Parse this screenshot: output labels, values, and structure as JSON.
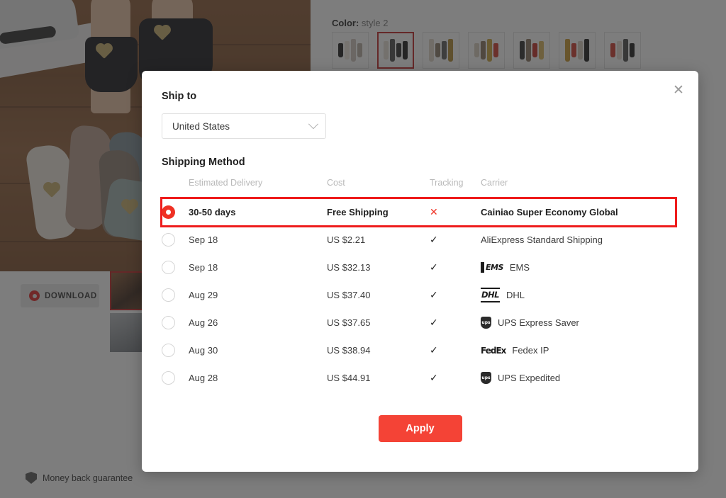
{
  "background": {
    "color_label": "Color:",
    "color_value": "style 2",
    "download_label": "DOWNLOAD",
    "money_back": "Money back guarantee",
    "swatches": [
      {
        "name": "swatch-1",
        "colors": [
          "#1a1a1a",
          "#efe6dd",
          "#cfc6bd",
          "#b9ada2"
        ]
      },
      {
        "name": "swatch-2",
        "colors": [
          "#e8e0d6",
          "#4a4a4a",
          "#2a2a2a",
          "#1a1a1a"
        ]
      },
      {
        "name": "swatch-3",
        "colors": [
          "#e0d6c8",
          "#8a7a66",
          "#5a5a5a",
          "#b08a30"
        ]
      },
      {
        "name": "swatch-4",
        "colors": [
          "#d8cdbd",
          "#8a7560",
          "#caa23a",
          "#d0392b"
        ]
      },
      {
        "name": "swatch-5",
        "colors": [
          "#2a2a2a",
          "#8a7560",
          "#c22a22",
          "#d8b45a"
        ]
      },
      {
        "name": "swatch-6",
        "colors": [
          "#c8962c",
          "#d0392b",
          "#d8cdbd",
          "#1a1a1a"
        ]
      },
      {
        "name": "swatch-7",
        "colors": [
          "#d0392b",
          "#e6ddd2",
          "#4a4a4a",
          "#1a1a1a"
        ]
      }
    ]
  },
  "modal": {
    "close_icon": "close-icon",
    "ship_to_title": "Ship to",
    "country": {
      "value": "United States",
      "chevron_icon": "chevron-down-icon"
    },
    "shipping_method_title": "Shipping Method",
    "columns": [
      "",
      "Estimated Delivery",
      "Cost",
      "Tracking",
      "Carrier"
    ],
    "rows": [
      {
        "selected": true,
        "eta": "30-50 days",
        "cost": "Free Shipping",
        "tracking": "✕",
        "tracking_icon": "cross-icon",
        "carrier": "Cainiao Super Economy Global",
        "logo": ""
      },
      {
        "selected": false,
        "eta": "Sep 18",
        "cost": "US $2.21",
        "tracking": "✓",
        "tracking_icon": "check-icon",
        "carrier": "AliExpress Standard Shipping",
        "logo": ""
      },
      {
        "selected": false,
        "eta": "Sep 18",
        "cost": "US $32.13",
        "tracking": "✓",
        "tracking_icon": "check-icon",
        "carrier": "EMS",
        "logo": "ems"
      },
      {
        "selected": false,
        "eta": "Aug 29",
        "cost": "US $37.40",
        "tracking": "✓",
        "tracking_icon": "check-icon",
        "carrier": "DHL",
        "logo": "dhl"
      },
      {
        "selected": false,
        "eta": "Aug 26",
        "cost": "US $37.65",
        "tracking": "✓",
        "tracking_icon": "check-icon",
        "carrier": "UPS Express Saver",
        "logo": "ups"
      },
      {
        "selected": false,
        "eta": "Aug 30",
        "cost": "US $38.94",
        "tracking": "✓",
        "tracking_icon": "check-icon",
        "carrier": "Fedex IP",
        "logo": "fedex"
      },
      {
        "selected": false,
        "eta": "Aug 28",
        "cost": "US $44.91",
        "tracking": "✓",
        "tracking_icon": "check-icon",
        "carrier": "UPS Expedited",
        "logo": "ups"
      }
    ],
    "apply_label": "Apply"
  },
  "colors": {
    "accent_red": "#ef3124",
    "highlight_red": "#ee1c1c",
    "apply_red": "#f44336",
    "overlay": "rgba(45,45,45,0.62)"
  }
}
